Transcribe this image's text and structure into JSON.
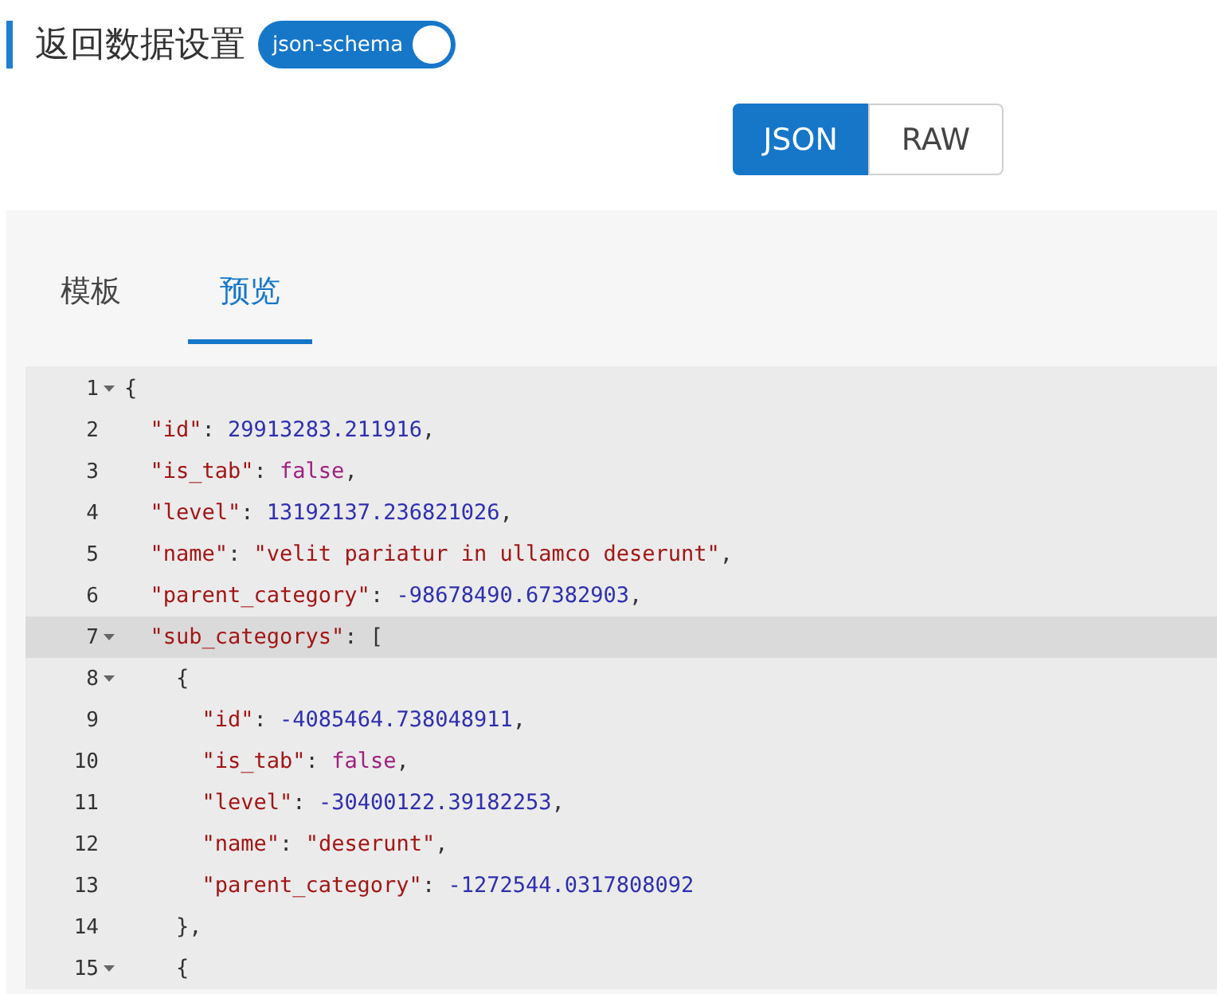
{
  "header": {
    "title": "返回数据设置",
    "toggle": {
      "label": "json-schema",
      "on": true
    }
  },
  "format_buttons": [
    {
      "label": "JSON",
      "selected": true
    },
    {
      "label": "RAW",
      "selected": false
    }
  ],
  "tabs": [
    {
      "label": "模板",
      "selected": false
    },
    {
      "label": "预览",
      "selected": true
    }
  ],
  "editor": {
    "lines": [
      {
        "number": "1",
        "foldable": true,
        "active": false,
        "tokens": [
          {
            "kind": "punct",
            "text": "{"
          }
        ]
      },
      {
        "number": "2",
        "foldable": false,
        "active": false,
        "tokens": [
          {
            "kind": "key",
            "text": "  \"id\""
          },
          {
            "kind": "punct",
            "text": ": "
          },
          {
            "kind": "number",
            "text": "29913283.211916"
          },
          {
            "kind": "punct",
            "text": ","
          }
        ]
      },
      {
        "number": "3",
        "foldable": false,
        "active": false,
        "tokens": [
          {
            "kind": "key",
            "text": "  \"is_tab\""
          },
          {
            "kind": "punct",
            "text": ": "
          },
          {
            "kind": "boolean",
            "text": "false"
          },
          {
            "kind": "punct",
            "text": ","
          }
        ]
      },
      {
        "number": "4",
        "foldable": false,
        "active": false,
        "tokens": [
          {
            "kind": "key",
            "text": "  \"level\""
          },
          {
            "kind": "punct",
            "text": ": "
          },
          {
            "kind": "number",
            "text": "13192137.236821026"
          },
          {
            "kind": "punct",
            "text": ","
          }
        ]
      },
      {
        "number": "5",
        "foldable": false,
        "active": false,
        "tokens": [
          {
            "kind": "key",
            "text": "  \"name\""
          },
          {
            "kind": "punct",
            "text": ": "
          },
          {
            "kind": "string",
            "text": "\"velit pariatur in ullamco deserunt\""
          },
          {
            "kind": "punct",
            "text": ","
          }
        ]
      },
      {
        "number": "6",
        "foldable": false,
        "active": false,
        "tokens": [
          {
            "kind": "key",
            "text": "  \"parent_category\""
          },
          {
            "kind": "punct",
            "text": ": "
          },
          {
            "kind": "number",
            "text": "-98678490.67382903"
          },
          {
            "kind": "punct",
            "text": ","
          }
        ]
      },
      {
        "number": "7",
        "foldable": true,
        "active": true,
        "tokens": [
          {
            "kind": "key",
            "text": "  \"sub_categorys\""
          },
          {
            "kind": "punct",
            "text": ": ["
          }
        ]
      },
      {
        "number": "8",
        "foldable": true,
        "active": false,
        "tokens": [
          {
            "kind": "punct",
            "text": "    {"
          }
        ]
      },
      {
        "number": "9",
        "foldable": false,
        "active": false,
        "tokens": [
          {
            "kind": "key",
            "text": "      \"id\""
          },
          {
            "kind": "punct",
            "text": ": "
          },
          {
            "kind": "number",
            "text": "-4085464.738048911"
          },
          {
            "kind": "punct",
            "text": ","
          }
        ]
      },
      {
        "number": "10",
        "foldable": false,
        "active": false,
        "tokens": [
          {
            "kind": "key",
            "text": "      \"is_tab\""
          },
          {
            "kind": "punct",
            "text": ": "
          },
          {
            "kind": "boolean",
            "text": "false"
          },
          {
            "kind": "punct",
            "text": ","
          }
        ]
      },
      {
        "number": "11",
        "foldable": false,
        "active": false,
        "tokens": [
          {
            "kind": "key",
            "text": "      \"level\""
          },
          {
            "kind": "punct",
            "text": ": "
          },
          {
            "kind": "number",
            "text": "-30400122.39182253"
          },
          {
            "kind": "punct",
            "text": ","
          }
        ]
      },
      {
        "number": "12",
        "foldable": false,
        "active": false,
        "tokens": [
          {
            "kind": "key",
            "text": "      \"name\""
          },
          {
            "kind": "punct",
            "text": ": "
          },
          {
            "kind": "string",
            "text": "\"deserunt\""
          },
          {
            "kind": "punct",
            "text": ","
          }
        ]
      },
      {
        "number": "13",
        "foldable": false,
        "active": false,
        "tokens": [
          {
            "kind": "key",
            "text": "      \"parent_category\""
          },
          {
            "kind": "punct",
            "text": ": "
          },
          {
            "kind": "number",
            "text": "-1272544.0317808092"
          }
        ]
      },
      {
        "number": "14",
        "foldable": false,
        "active": false,
        "tokens": [
          {
            "kind": "punct",
            "text": "    },"
          }
        ]
      },
      {
        "number": "15",
        "foldable": true,
        "active": false,
        "tokens": [
          {
            "kind": "punct",
            "text": "    {"
          }
        ]
      }
    ]
  }
}
